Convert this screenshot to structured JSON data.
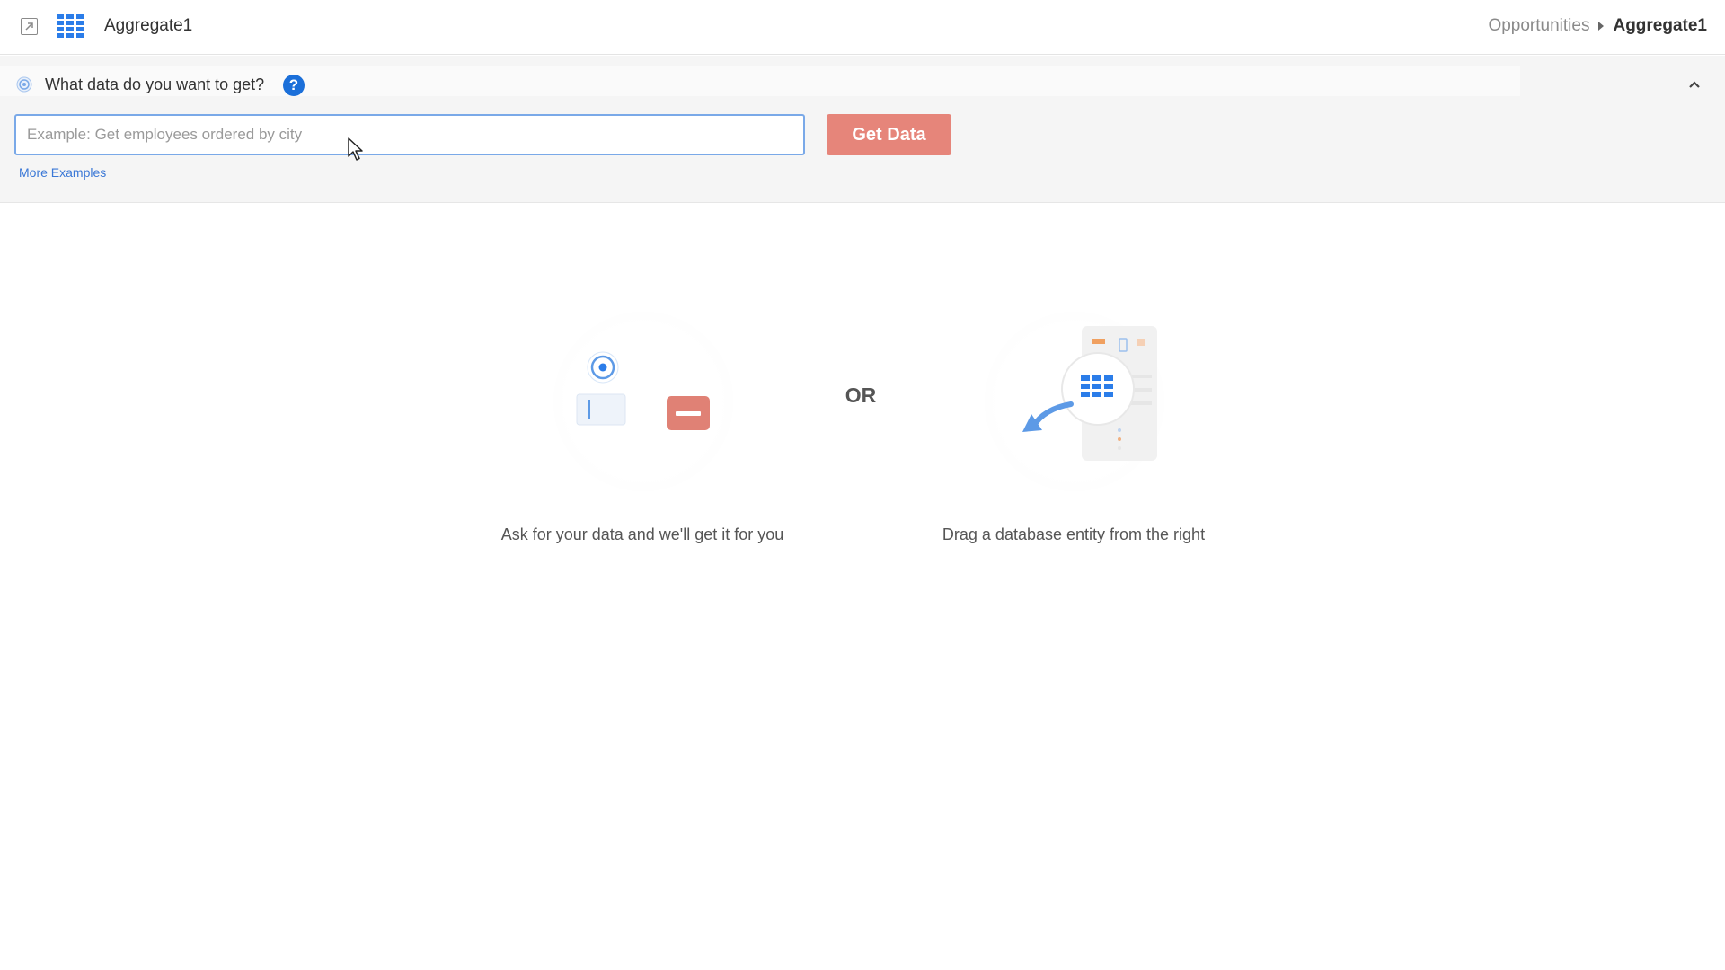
{
  "header": {
    "title": "Aggregate1",
    "breadcrumb": [
      {
        "label": "Opportunities"
      },
      {
        "label": "Aggregate1"
      }
    ]
  },
  "query": {
    "question": "What data do you want to get?",
    "help_symbol": "?",
    "input_value": "",
    "input_placeholder": "Example: Get employees ordered by city",
    "get_data_label": "Get Data",
    "more_examples_label": "More Examples"
  },
  "empty_state": {
    "or_label": "OR",
    "ask_caption": "Ask for your data and we'll get it for you",
    "drag_caption": "Drag a database entity from the right"
  },
  "colors": {
    "accent_blue": "#1b6fd9",
    "button_red": "#e6857a",
    "link_blue": "#3b78d6"
  }
}
